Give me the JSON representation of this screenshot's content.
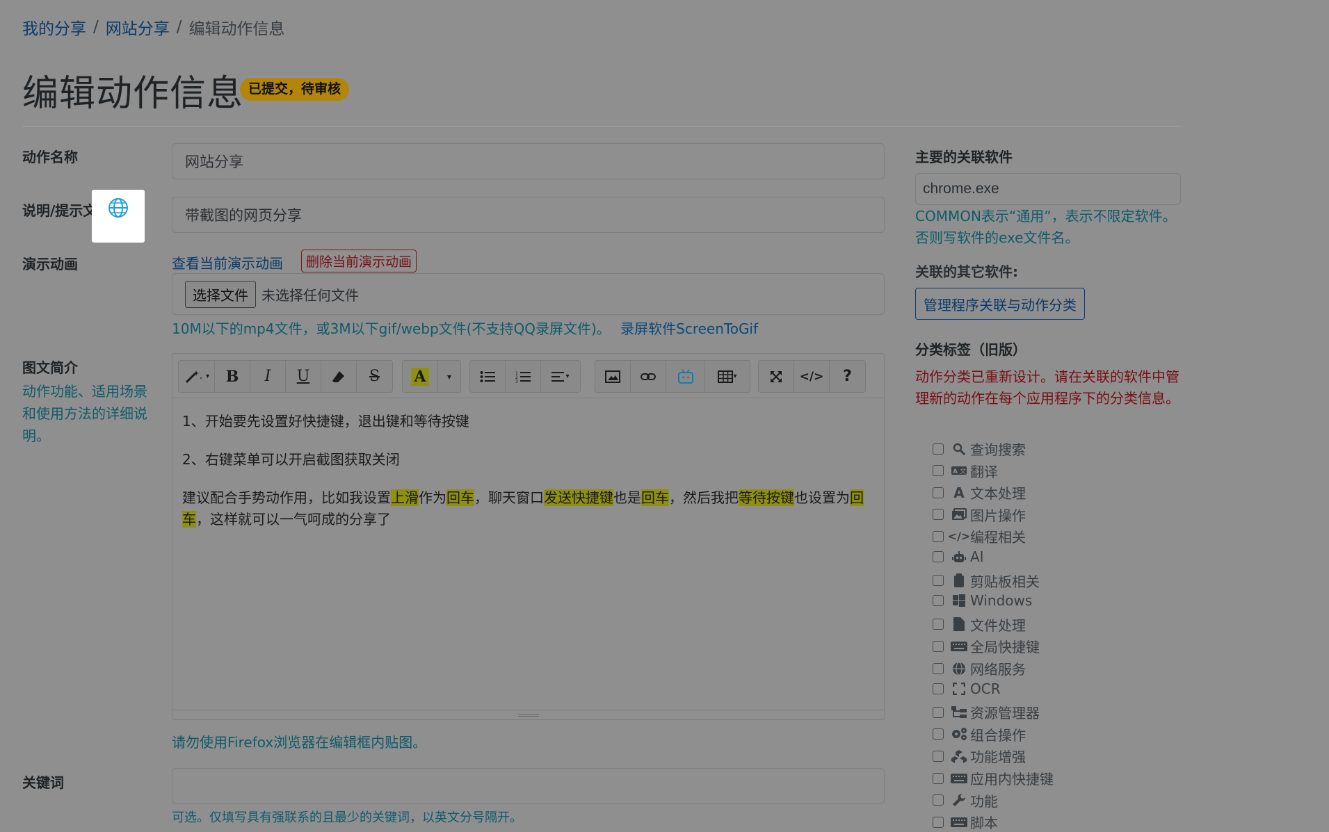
{
  "breadcrumb": {
    "items": [
      "我的分享",
      "网站分享"
    ],
    "sep": "/",
    "current": "编辑动作信息"
  },
  "page": {
    "title": "编辑动作信息",
    "status": "已提交，待审核"
  },
  "form": {
    "name_label": "动作名称",
    "name_value": "网站分享",
    "desc_label": "说明/提示文",
    "desc_value": "带截图的网页分享",
    "demo_label": "演示动画",
    "view_demo": "查看当前演示动画",
    "delete_demo": "删除当前演示动画",
    "file_button": "选择文件",
    "file_status": "未选择任何文件",
    "file_hint": "10M以下的mp4文件，或3M以下gif/webp文件(不支持QQ录屏文件)。",
    "file_hint_link": "录屏软件ScreenToGif",
    "intro_label": "图文简介",
    "intro_desc": "动作功能、适用场景和使用方法的详细说明。",
    "editor_paragraphs": {
      "p1": "1、开始要先设置好快捷键，退出键和等待按键",
      "p2": "2、右键菜单可以开启截图获取关闭",
      "p3": [
        "建议配合手势动作用，比如我设置",
        "上滑",
        "作为",
        "回车",
        "，聊天窗口",
        "发送快捷键",
        "也是",
        "回车",
        "，然后我把",
        "等待按键",
        "也设置为",
        "回车",
        "，这样就可以一气呵成的分享了"
      ]
    },
    "firefox_hint": "请勿使用Firefox浏览器在编辑框内贴图。",
    "keywords_label": "关键词",
    "keywords_value": "",
    "keywords_hint": "可选。仅填写具有强联系的且最少的关键词，以英文分号隔开。"
  },
  "sidebar": {
    "main_app_label": "主要的关联软件",
    "main_app_value": "chrome.exe",
    "main_app_hint": "COMMON表示“通用”，表示不限定软件。否则写软件的exe文件名。",
    "other_apps_label": "关联的其它软件:",
    "manage_button": "管理程序关联与动作分类",
    "category_label": "分类标签（旧版）",
    "category_notice": "动作分类已重新设计。请在关联的软件中管理新的动作在每个应用程序下的分类信息。",
    "categories": [
      {
        "icon": "search-icon",
        "label": "查询搜索"
      },
      {
        "icon": "translate-icon",
        "label": "翻译"
      },
      {
        "icon": "font-icon",
        "label": "文本处理"
      },
      {
        "icon": "images-icon",
        "label": "图片操作"
      },
      {
        "icon": "code-icon",
        "label": "编程相关"
      },
      {
        "icon": "robot-icon",
        "label": "AI"
      },
      {
        "icon": "clipboard-icon",
        "label": "剪贴板相关"
      },
      {
        "icon": "windows-icon",
        "label": "Windows"
      },
      {
        "icon": "file-icon",
        "label": "文件处理"
      },
      {
        "icon": "keyboard-icon",
        "label": "全局快捷键"
      },
      {
        "icon": "globe-icon",
        "label": "网络服务"
      },
      {
        "icon": "scan-icon",
        "label": "OCR"
      },
      {
        "icon": "sitemap-icon",
        "label": "资源管理器"
      },
      {
        "icon": "gears-icon",
        "label": "组合操作"
      },
      {
        "icon": "cubes-icon",
        "label": "功能增强"
      },
      {
        "icon": "keyboard-icon",
        "label": "应用内快捷键"
      },
      {
        "icon": "wrench-icon",
        "label": "功能"
      },
      {
        "icon": "keyboard-icon",
        "label": "脚本"
      }
    ]
  }
}
